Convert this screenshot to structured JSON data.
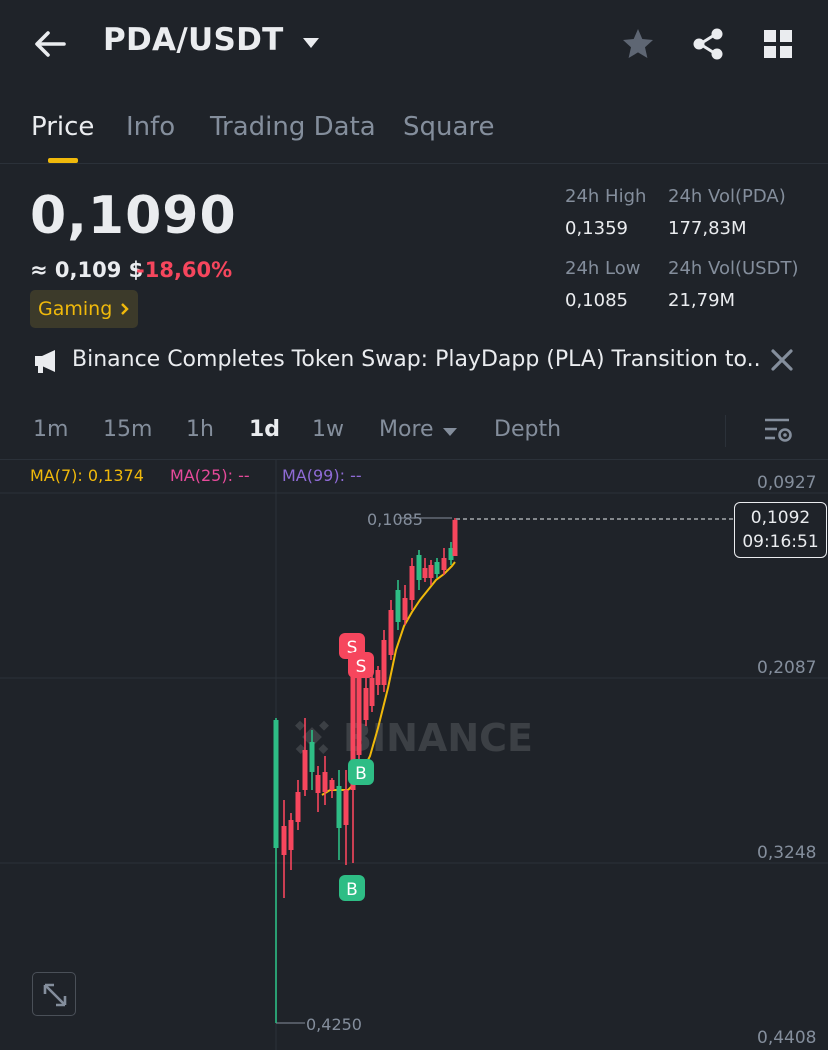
{
  "header": {
    "pair": "PDA/USDT",
    "icons": [
      "back-arrow-icon",
      "caret-down-icon",
      "star-icon",
      "share-icon",
      "grid-icon"
    ]
  },
  "tabs": [
    {
      "label": "Price",
      "active": true
    },
    {
      "label": "Info",
      "active": false
    },
    {
      "label": "Trading Data",
      "active": false
    },
    {
      "label": "Square",
      "active": false
    }
  ],
  "price": {
    "last": "0,1090",
    "approx": "≈ 0,109 $",
    "change": "-18,60%",
    "tag": "Gaming"
  },
  "stats": {
    "high_label": "24h High",
    "high_value": "0,1359",
    "vol_base_label": "24h Vol(PDA)",
    "vol_base_value": "177,83M",
    "low_label": "24h Low",
    "low_value": "0,1085",
    "vol_quote_label": "24h Vol(USDT)",
    "vol_quote_value": "21,79M"
  },
  "news": {
    "text": "Binance Completes Token Swap: PlayDapp (PLA) Transition to..."
  },
  "intervals": {
    "items": [
      "1m",
      "15m",
      "1h",
      "1d",
      "1w",
      "More",
      "Depth"
    ],
    "active": "1d"
  },
  "indicators": {
    "ma7": "MA(7): 0,1374",
    "ma25": "MA(25): --",
    "ma99": "MA(99): --"
  },
  "chart": {
    "axis_labels": [
      "0,0927",
      "0,2087",
      "0,3248",
      "0,4408"
    ],
    "max_marker": "0,1085",
    "min_marker": "0,4250",
    "current_price": "0,1092",
    "countdown": "09:16:51",
    "watermark": "BINANCE",
    "markers": [
      "S",
      "S",
      "B",
      "B"
    ]
  },
  "colors": {
    "background": "#1f2329",
    "up": "#2ebd85",
    "down": "#f6465d",
    "accent": "#f0b90b",
    "ma25": "#e64a9a",
    "ma99": "#8f6bd6"
  }
}
